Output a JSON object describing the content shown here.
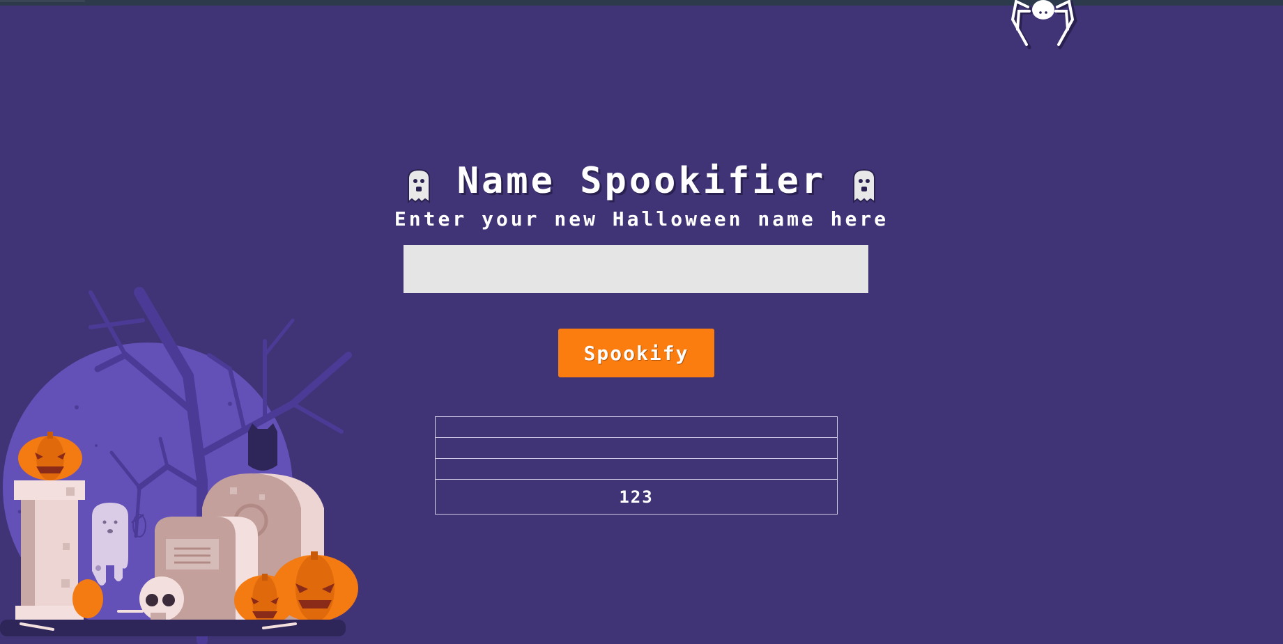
{
  "header": {
    "title": "Name Spookifier",
    "left_icon": "ghost-icon",
    "right_icon": "ghost-icon"
  },
  "form": {
    "subtitle": "Enter your new Halloween name here",
    "input_value": "",
    "input_placeholder": "",
    "button_label": "Spookify"
  },
  "results": {
    "rows": [
      "",
      "",
      "",
      "123"
    ]
  },
  "decorations": {
    "spider": "spider-icon",
    "scene": "graveyard-illustration"
  },
  "colors": {
    "background": "#413476",
    "button": "#fb7d10",
    "input": "#e5e5e5",
    "moon": "#6451b8",
    "pumpkin": "#f47a12"
  }
}
